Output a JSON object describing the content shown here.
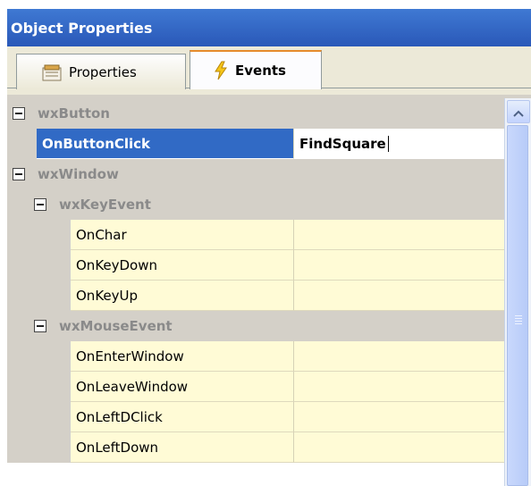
{
  "window": {
    "title": "Object Properties"
  },
  "tabs": {
    "properties": "Properties",
    "events": "Events"
  },
  "grid": {
    "wxButton": "wxButton",
    "onButtonClick": {
      "name": "OnButtonClick",
      "value": "FindSquare"
    },
    "wxWindow": "wxWindow",
    "wxKeyEvent": "wxKeyEvent",
    "keyEvents": [
      "OnChar",
      "OnKeyDown",
      "OnKeyUp"
    ],
    "wxMouseEvent": "wxMouseEvent",
    "mouseEvents": [
      "OnEnterWindow",
      "OnLeaveWindow",
      "OnLeftDClick",
      "OnLeftDown"
    ]
  }
}
